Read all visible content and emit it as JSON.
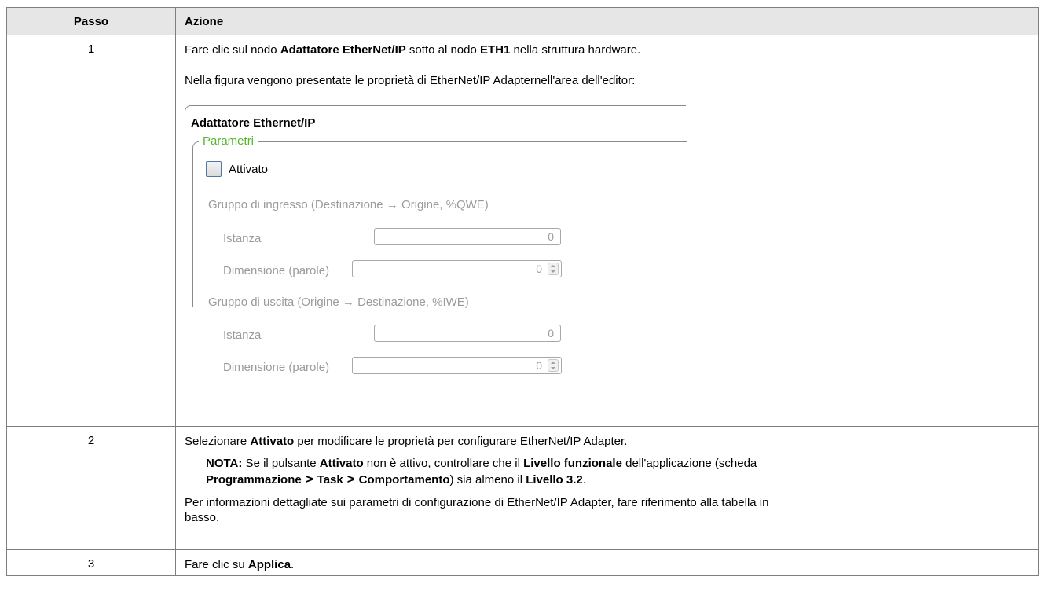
{
  "table": {
    "headers": {
      "step": "Passo",
      "action": "Azione"
    },
    "rows": [
      {
        "step": "1"
      },
      {
        "step": "2"
      },
      {
        "step": "3"
      }
    ]
  },
  "row1": {
    "p1": {
      "t1": "Fare clic sul nodo ",
      "b1": "Adattatore EtherNet/IP",
      "t2": " sotto al nodo ",
      "b2": "ETH1",
      "t3": " nella struttura hardware."
    },
    "p2": "Nella figura vengono presentate le proprietà di EtherNet/IP Adapternell'area dell'editor:",
    "figure": {
      "title": "Adattatore Ethernet/IP",
      "group_legend": "Parametri",
      "enabled_label": "Attivato",
      "input_group": "Gruppo di ingresso (Destinazione → Origine, %QWE)",
      "output_group": "Gruppo di uscita (Origine → Destinazione, %IWE)",
      "instance_label": "Istanza",
      "size_label": "Dimensione (parole)",
      "input_instance": "0",
      "input_size": "0",
      "output_instance": "0",
      "output_size": "0"
    }
  },
  "row2": {
    "p1": {
      "t1": "Selezionare ",
      "b1": "Attivato",
      "t2": " per modificare le proprietà per configurare EtherNet/IP Adapter."
    },
    "note": {
      "label": "NOTA:",
      "t1": " Se il pulsante ",
      "b1": "Attivato",
      "t2": " non è attivo, controllare che il ",
      "b2": "Livello funzionale",
      "t3": " dell'applicazione (scheda",
      "b3": "Programmazione",
      "gt1": ">",
      "b4": "Task",
      "gt2": ">",
      "b5": "Comportamento",
      "t4": ") sia almeno il ",
      "b6": "Livello 3.2",
      "t5": "."
    },
    "p2a": "Per informazioni dettagliate sui parametri di configurazione di EtherNet/IP Adapter, fare riferimento alla tabella in",
    "p2b": "basso."
  },
  "row3": {
    "t1": "Fare clic su ",
    "b1": "Applica",
    "t2": "."
  }
}
